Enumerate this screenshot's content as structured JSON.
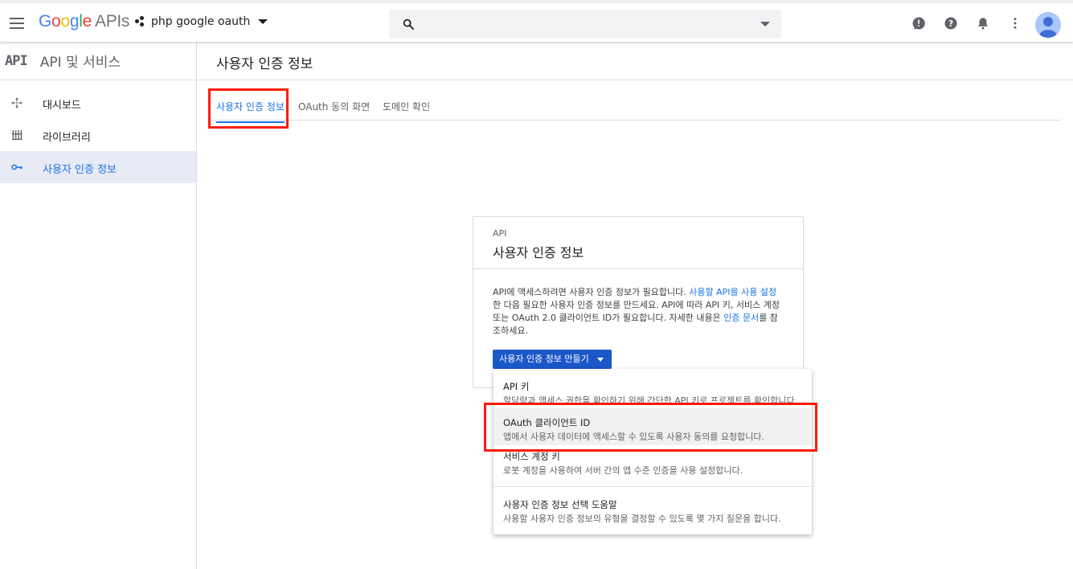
{
  "header": {
    "logo_google": [
      "G",
      "o",
      "o",
      "g",
      "l",
      "e"
    ],
    "logo_apis": "APIs",
    "project_name": "php google oauth",
    "search_placeholder": ""
  },
  "sidebar": {
    "api_logo": "API",
    "title": "API 및 서비스",
    "items": [
      {
        "label": "대시보드",
        "icon": "dashboard-icon",
        "active": false
      },
      {
        "label": "라이브러리",
        "icon": "library-icon",
        "active": false
      },
      {
        "label": "사용자 인증 정보",
        "icon": "key-icon",
        "active": true
      }
    ]
  },
  "main": {
    "page_title": "사용자 인증 정보",
    "tabs": [
      {
        "label": "사용자 인증 정보",
        "active": true
      },
      {
        "label": "OAuth 동의 화면",
        "active": false
      },
      {
        "label": "도메인 확인",
        "active": false
      }
    ]
  },
  "card": {
    "subtitle": "API",
    "title": "사용자 인증 정보",
    "body_part1": "API에 액세스하려면 사용자 인증 정보가 필요합니다. ",
    "body_link1": "사용할 API를 사용 설정",
    "body_part2": "한 다음 필요한 사용자 인증 정보를 만드세요. API에 따라 API 키, 서비스 계정 또는 OAuth 2.0 클라이언트 ID가 필요합니다. 자세한 내용은 ",
    "body_link2": "인증 문서",
    "body_part3": "를 참조하세요.",
    "create_button": "사용자 인증 정보 만들기"
  },
  "menu": {
    "items": [
      {
        "title": "API 키",
        "desc": "할당량과 액세스 권한을 확인하기 위해 간단한 API 키로 프로젝트를 확인합니다."
      },
      {
        "title": "OAuth 클라이언트 ID",
        "desc": "앱에서 사용자 데이터에 액세스할 수 있도록 사용자 동의를 요청합니다."
      },
      {
        "title": "서비스 계정 키",
        "desc": "로봇 계정을 사용하여 서버 간의 앱 수준 인증을 사용 설정합니다."
      },
      {
        "title": "사용자 인증 정보 선택 도움말",
        "desc": "사용할 사용자 인증 정보의 유형을 결정할 수 있도록 몇 가지 질문을 합니다."
      }
    ]
  },
  "colors": {
    "accent": "#1a73e8",
    "button": "#1a57c8",
    "highlight_box": "#ff1a0d"
  }
}
